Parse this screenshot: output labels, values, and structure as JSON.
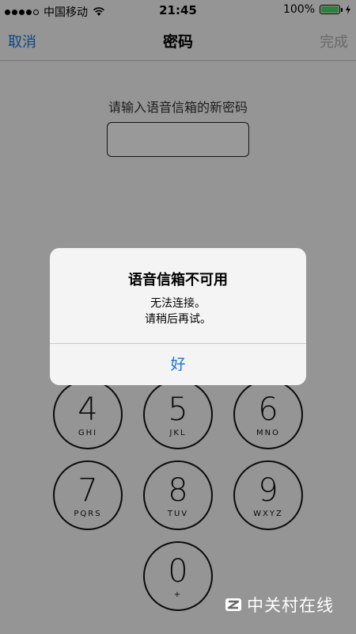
{
  "status_bar": {
    "carrier": "中国移动",
    "time": "21:45",
    "battery_percent": "100%",
    "battery_level": 1.0,
    "signal_filled": 4,
    "signal_total": 5
  },
  "nav": {
    "cancel_label": "取消",
    "title": "密码",
    "done_label": "完成"
  },
  "form": {
    "prompt": "请输入语音信箱的新密码",
    "password_value": ""
  },
  "keypad": [
    {
      "num": "4",
      "letters": "GHI"
    },
    {
      "num": "5",
      "letters": "JKL"
    },
    {
      "num": "6",
      "letters": "MNO"
    },
    {
      "num": "7",
      "letters": "PQRS"
    },
    {
      "num": "8",
      "letters": "TUV"
    },
    {
      "num": "9",
      "letters": "WXYZ"
    },
    {
      "num": "0",
      "letters": "+"
    }
  ],
  "alert": {
    "title": "语音信箱不可用",
    "message_line1": "无法连接。",
    "message_line2": "请稍后再试。",
    "ok_label": "好"
  },
  "watermark": {
    "text": "中关村在线"
  },
  "colors": {
    "link": "#1a73d8",
    "disabled": "#b0b0b0",
    "battery": "#4cd964"
  }
}
